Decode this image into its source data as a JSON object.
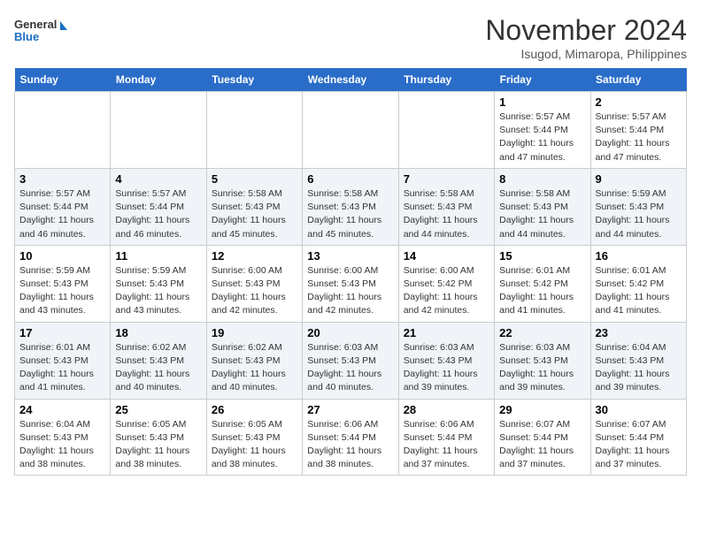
{
  "header": {
    "logo_line1": "General",
    "logo_line2": "Blue",
    "month": "November 2024",
    "location": "Isugod, Mimaropa, Philippines"
  },
  "weekdays": [
    "Sunday",
    "Monday",
    "Tuesday",
    "Wednesday",
    "Thursday",
    "Friday",
    "Saturday"
  ],
  "weeks": [
    [
      {
        "day": "",
        "info": ""
      },
      {
        "day": "",
        "info": ""
      },
      {
        "day": "",
        "info": ""
      },
      {
        "day": "",
        "info": ""
      },
      {
        "day": "",
        "info": ""
      },
      {
        "day": "1",
        "info": "Sunrise: 5:57 AM\nSunset: 5:44 PM\nDaylight: 11 hours\nand 47 minutes."
      },
      {
        "day": "2",
        "info": "Sunrise: 5:57 AM\nSunset: 5:44 PM\nDaylight: 11 hours\nand 47 minutes."
      }
    ],
    [
      {
        "day": "3",
        "info": "Sunrise: 5:57 AM\nSunset: 5:44 PM\nDaylight: 11 hours\nand 46 minutes."
      },
      {
        "day": "4",
        "info": "Sunrise: 5:57 AM\nSunset: 5:44 PM\nDaylight: 11 hours\nand 46 minutes."
      },
      {
        "day": "5",
        "info": "Sunrise: 5:58 AM\nSunset: 5:43 PM\nDaylight: 11 hours\nand 45 minutes."
      },
      {
        "day": "6",
        "info": "Sunrise: 5:58 AM\nSunset: 5:43 PM\nDaylight: 11 hours\nand 45 minutes."
      },
      {
        "day": "7",
        "info": "Sunrise: 5:58 AM\nSunset: 5:43 PM\nDaylight: 11 hours\nand 44 minutes."
      },
      {
        "day": "8",
        "info": "Sunrise: 5:58 AM\nSunset: 5:43 PM\nDaylight: 11 hours\nand 44 minutes."
      },
      {
        "day": "9",
        "info": "Sunrise: 5:59 AM\nSunset: 5:43 PM\nDaylight: 11 hours\nand 44 minutes."
      }
    ],
    [
      {
        "day": "10",
        "info": "Sunrise: 5:59 AM\nSunset: 5:43 PM\nDaylight: 11 hours\nand 43 minutes."
      },
      {
        "day": "11",
        "info": "Sunrise: 5:59 AM\nSunset: 5:43 PM\nDaylight: 11 hours\nand 43 minutes."
      },
      {
        "day": "12",
        "info": "Sunrise: 6:00 AM\nSunset: 5:43 PM\nDaylight: 11 hours\nand 42 minutes."
      },
      {
        "day": "13",
        "info": "Sunrise: 6:00 AM\nSunset: 5:43 PM\nDaylight: 11 hours\nand 42 minutes."
      },
      {
        "day": "14",
        "info": "Sunrise: 6:00 AM\nSunset: 5:42 PM\nDaylight: 11 hours\nand 42 minutes."
      },
      {
        "day": "15",
        "info": "Sunrise: 6:01 AM\nSunset: 5:42 PM\nDaylight: 11 hours\nand 41 minutes."
      },
      {
        "day": "16",
        "info": "Sunrise: 6:01 AM\nSunset: 5:42 PM\nDaylight: 11 hours\nand 41 minutes."
      }
    ],
    [
      {
        "day": "17",
        "info": "Sunrise: 6:01 AM\nSunset: 5:43 PM\nDaylight: 11 hours\nand 41 minutes."
      },
      {
        "day": "18",
        "info": "Sunrise: 6:02 AM\nSunset: 5:43 PM\nDaylight: 11 hours\nand 40 minutes."
      },
      {
        "day": "19",
        "info": "Sunrise: 6:02 AM\nSunset: 5:43 PM\nDaylight: 11 hours\nand 40 minutes."
      },
      {
        "day": "20",
        "info": "Sunrise: 6:03 AM\nSunset: 5:43 PM\nDaylight: 11 hours\nand 40 minutes."
      },
      {
        "day": "21",
        "info": "Sunrise: 6:03 AM\nSunset: 5:43 PM\nDaylight: 11 hours\nand 39 minutes."
      },
      {
        "day": "22",
        "info": "Sunrise: 6:03 AM\nSunset: 5:43 PM\nDaylight: 11 hours\nand 39 minutes."
      },
      {
        "day": "23",
        "info": "Sunrise: 6:04 AM\nSunset: 5:43 PM\nDaylight: 11 hours\nand 39 minutes."
      }
    ],
    [
      {
        "day": "24",
        "info": "Sunrise: 6:04 AM\nSunset: 5:43 PM\nDaylight: 11 hours\nand 38 minutes."
      },
      {
        "day": "25",
        "info": "Sunrise: 6:05 AM\nSunset: 5:43 PM\nDaylight: 11 hours\nand 38 minutes."
      },
      {
        "day": "26",
        "info": "Sunrise: 6:05 AM\nSunset: 5:43 PM\nDaylight: 11 hours\nand 38 minutes."
      },
      {
        "day": "27",
        "info": "Sunrise: 6:06 AM\nSunset: 5:44 PM\nDaylight: 11 hours\nand 38 minutes."
      },
      {
        "day": "28",
        "info": "Sunrise: 6:06 AM\nSunset: 5:44 PM\nDaylight: 11 hours\nand 37 minutes."
      },
      {
        "day": "29",
        "info": "Sunrise: 6:07 AM\nSunset: 5:44 PM\nDaylight: 11 hours\nand 37 minutes."
      },
      {
        "day": "30",
        "info": "Sunrise: 6:07 AM\nSunset: 5:44 PM\nDaylight: 11 hours\nand 37 minutes."
      }
    ]
  ]
}
